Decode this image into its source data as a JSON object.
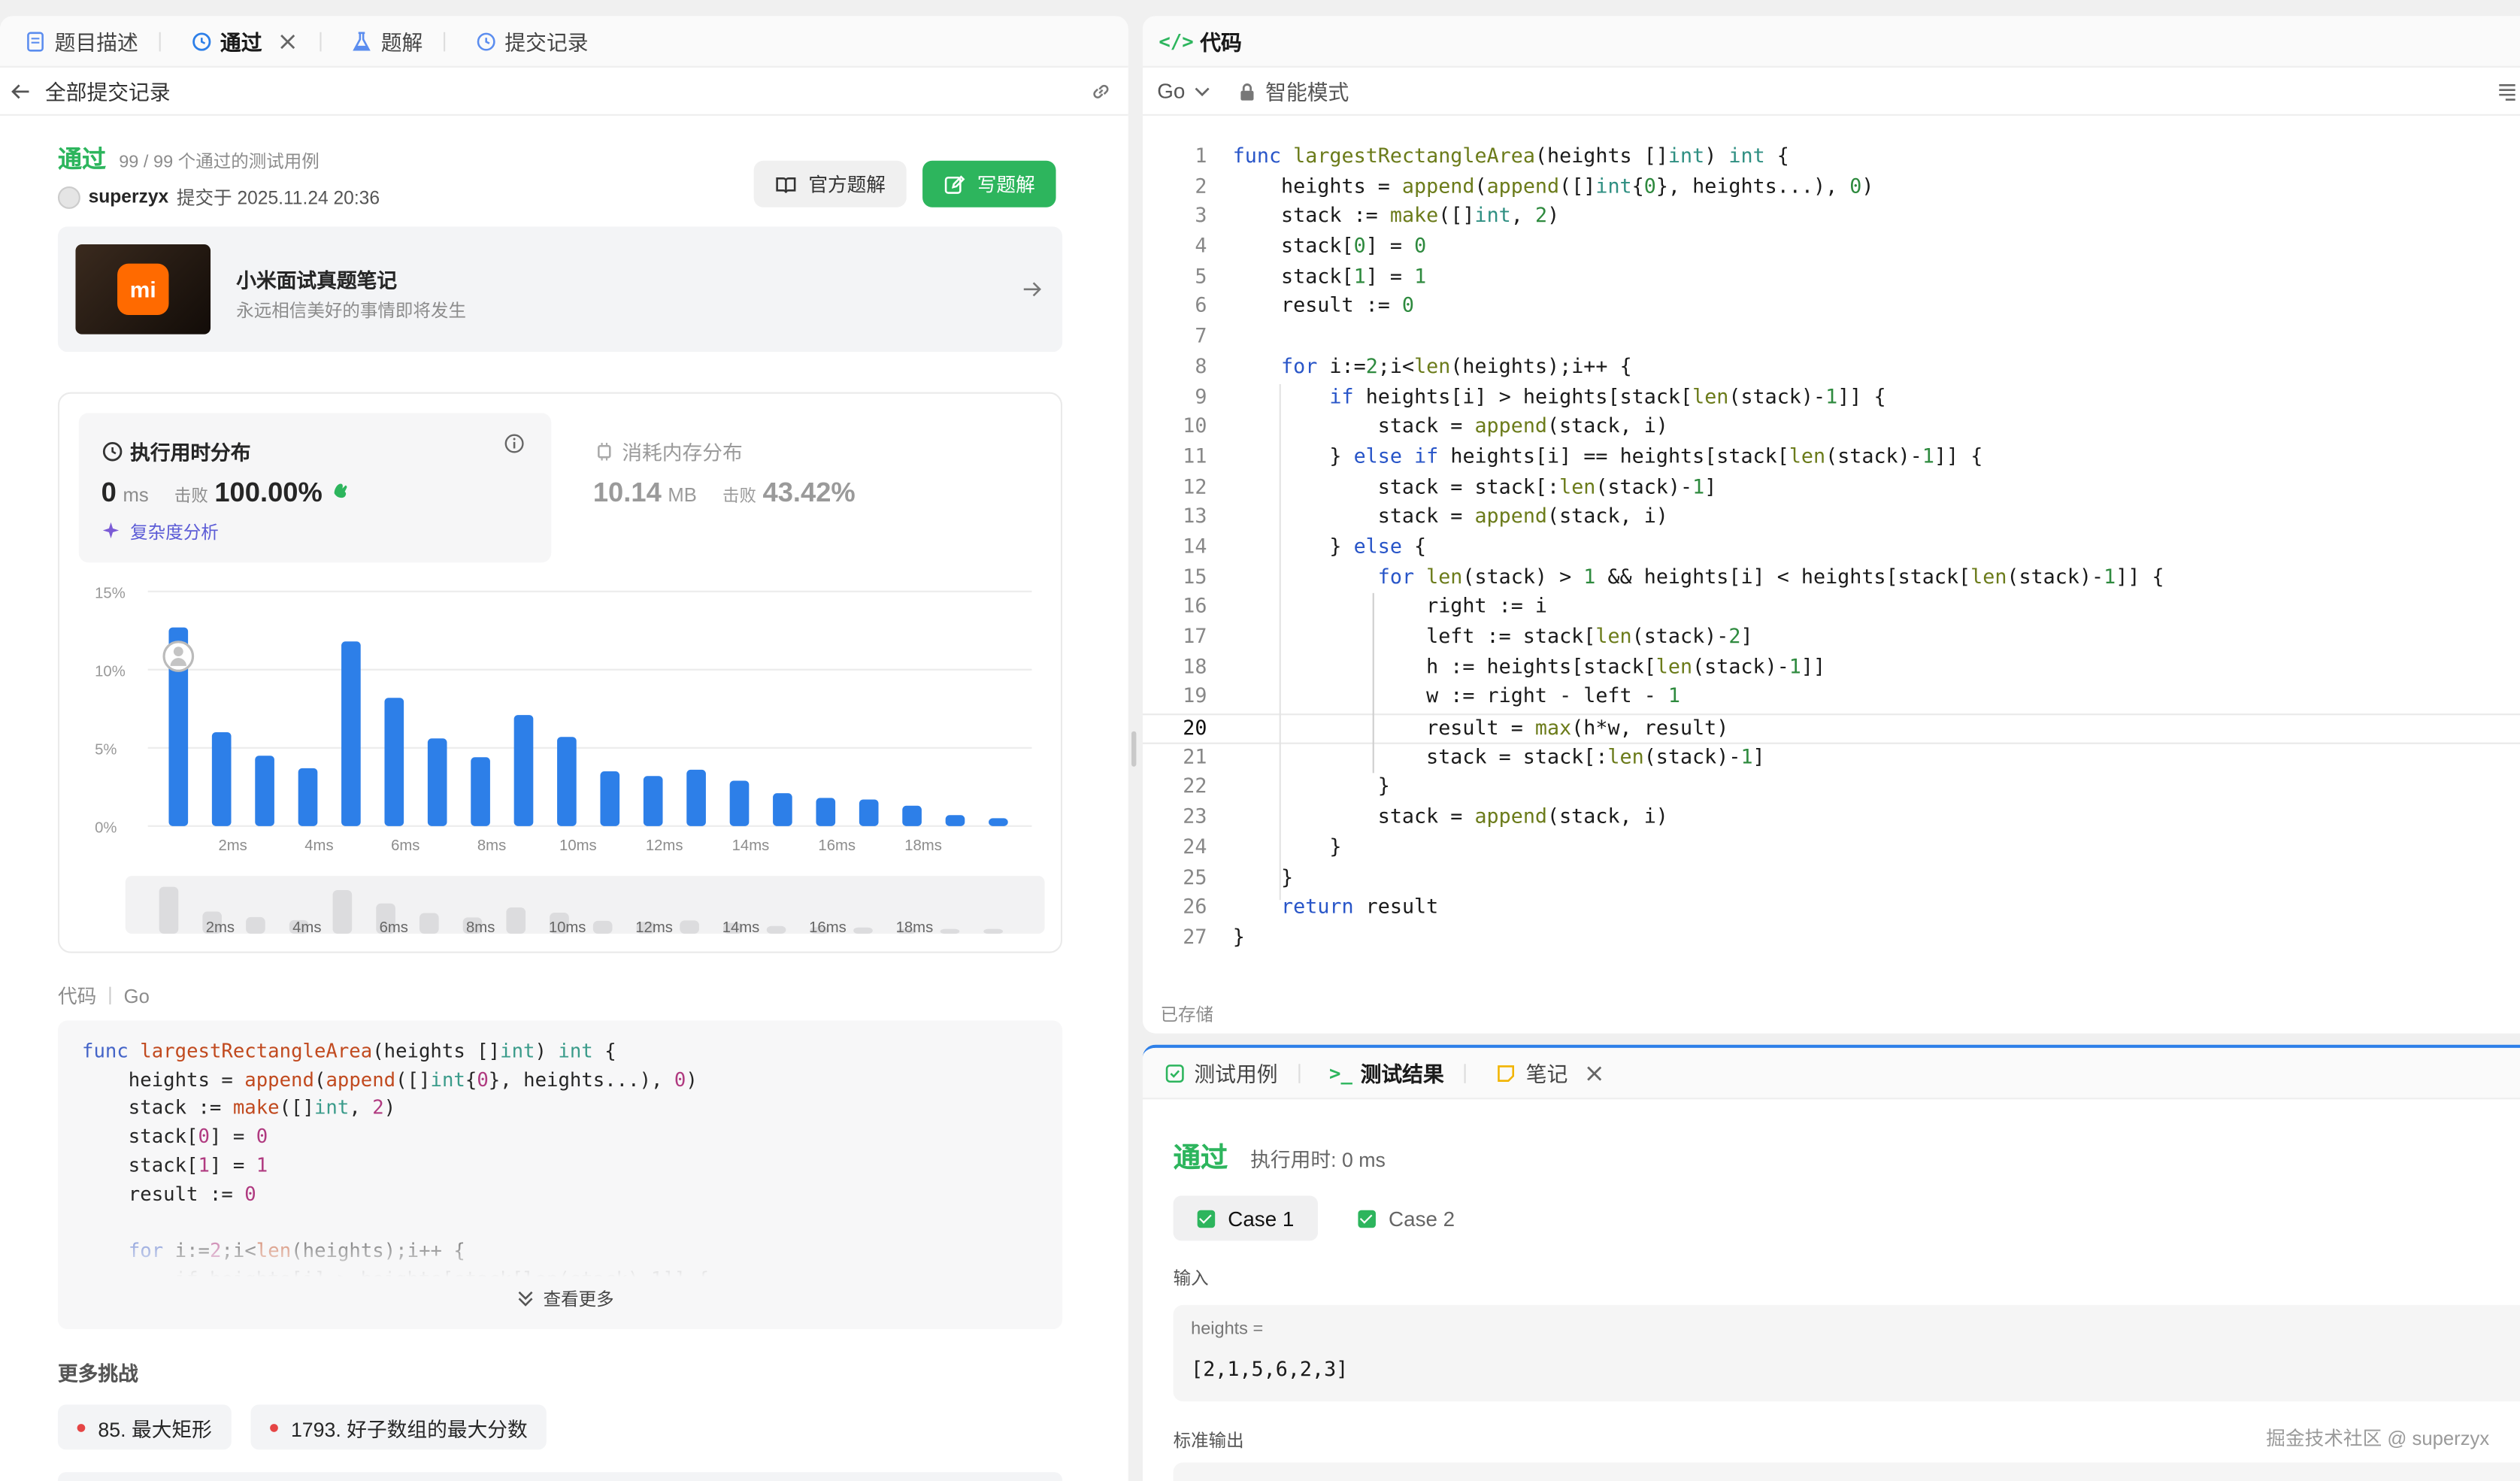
{
  "left_tabs": [
    {
      "label": "题目描述",
      "icon": "doc-icon"
    },
    {
      "label": "通过",
      "icon": "history-icon"
    },
    {
      "label": "题解",
      "icon": "flask-icon"
    },
    {
      "label": "提交记录",
      "icon": "history-icon"
    }
  ],
  "left_sub": {
    "back_label": "全部提交记录"
  },
  "result": {
    "status": "通过",
    "cases": "99 / 99 个通过的测试用例",
    "user": "superzyx",
    "submitted": "提交于 2025.11.24 20:36",
    "official_btn": "官方题解",
    "write_btn": "写题解"
  },
  "promo": {
    "logo": "mi",
    "title": "小米面试真题笔记",
    "subtitle": "永远相信美好的事情即将发生"
  },
  "runtime": {
    "title": "执行用时分布",
    "value": "0",
    "unit": "ms",
    "beats_label": "击败",
    "beats": "100.00%",
    "analysis": "复杂度分析"
  },
  "memory": {
    "title": "消耗内存分布",
    "value": "10.14",
    "unit": "MB",
    "beats_label": "击败",
    "beats": "43.42%"
  },
  "chart_data": {
    "type": "bar",
    "ylim": [
      0,
      15
    ],
    "yticks": [
      "15%",
      "10%",
      "5%",
      "0%"
    ],
    "tick_labels": [
      "2ms",
      "4ms",
      "6ms",
      "8ms",
      "10ms",
      "12ms",
      "14ms",
      "16ms",
      "18ms"
    ],
    "values": [
      12.7,
      6.0,
      4.5,
      3.7,
      11.8,
      8.2,
      5.6,
      4.4,
      7.1,
      5.7,
      3.5,
      3.2,
      3.6,
      2.9,
      2.1,
      1.8,
      1.7,
      1.3,
      0.7,
      0.5
    ],
    "highlight_index": 0
  },
  "code_section": {
    "label": "代码",
    "lang": "Go",
    "lines": [
      "func largestRectangleArea(heights []int) int {",
      "    heights = append(append([]int{0}, heights...), 0)",
      "    stack := make([]int, 2)",
      "    stack[0] = 0",
      "    stack[1] = 1",
      "    result := 0",
      "",
      "    for i:=2;i<len(heights);i++ {"
    ],
    "more": "查看更多"
  },
  "challenges": {
    "title": "更多挑战",
    "items": [
      "85. 最大矩形",
      "1793. 好子数组的最大分数"
    ]
  },
  "right_top": {
    "tab_label": "代码",
    "lang": "Go",
    "mode": "智能模式",
    "saved": "已存储",
    "current_line": 20,
    "lines": [
      "func largestRectangleArea(heights []int) int {",
      "    heights = append(append([]int{0}, heights...), 0)",
      "    stack := make([]int, 2)",
      "    stack[0] = 0",
      "    stack[1] = 1",
      "    result := 0",
      "",
      "    for i:=2;i<len(heights);i++ {",
      "        if heights[i] > heights[stack[len(stack)-1]] {",
      "            stack = append(stack, i)",
      "        } else if heights[i] == heights[stack[len(stack)-1]] {",
      "            stack = stack[:len(stack)-1]",
      "            stack = append(stack, i)",
      "        } else {",
      "            for len(stack) > 1 && heights[i] < heights[stack[len(stack)-1]] {",
      "                right := i",
      "                left := stack[len(stack)-2]",
      "                h := heights[stack[len(stack)-1]]",
      "                w := right - left - 1",
      "                result = max(h*w, result)",
      "                stack = stack[:len(stack)-1]",
      "            }",
      "            stack = append(stack, i)",
      "        }",
      "    }",
      "    return result",
      "}"
    ]
  },
  "right_bottom": {
    "tabs": [
      {
        "label": "测试用例",
        "icon": "checkbox-icon"
      },
      {
        "label": "测试结果",
        "icon": "terminal-icon"
      },
      {
        "label": "笔记",
        "icon": "note-icon"
      }
    ],
    "status": "通过",
    "runtime": "执行用时: 0 ms",
    "cases": [
      "Case 1",
      "Case 2"
    ],
    "input_label": "输入",
    "input_var": "heights =",
    "input_value": "[2,1,5,6,2,3]",
    "expected_label": "标准输出",
    "watermark": "掘金技术社区 @ superzyx"
  },
  "colors": {
    "accent": "#2db55d",
    "bar": "#2d7fe8",
    "link": "#2d7fe8"
  }
}
